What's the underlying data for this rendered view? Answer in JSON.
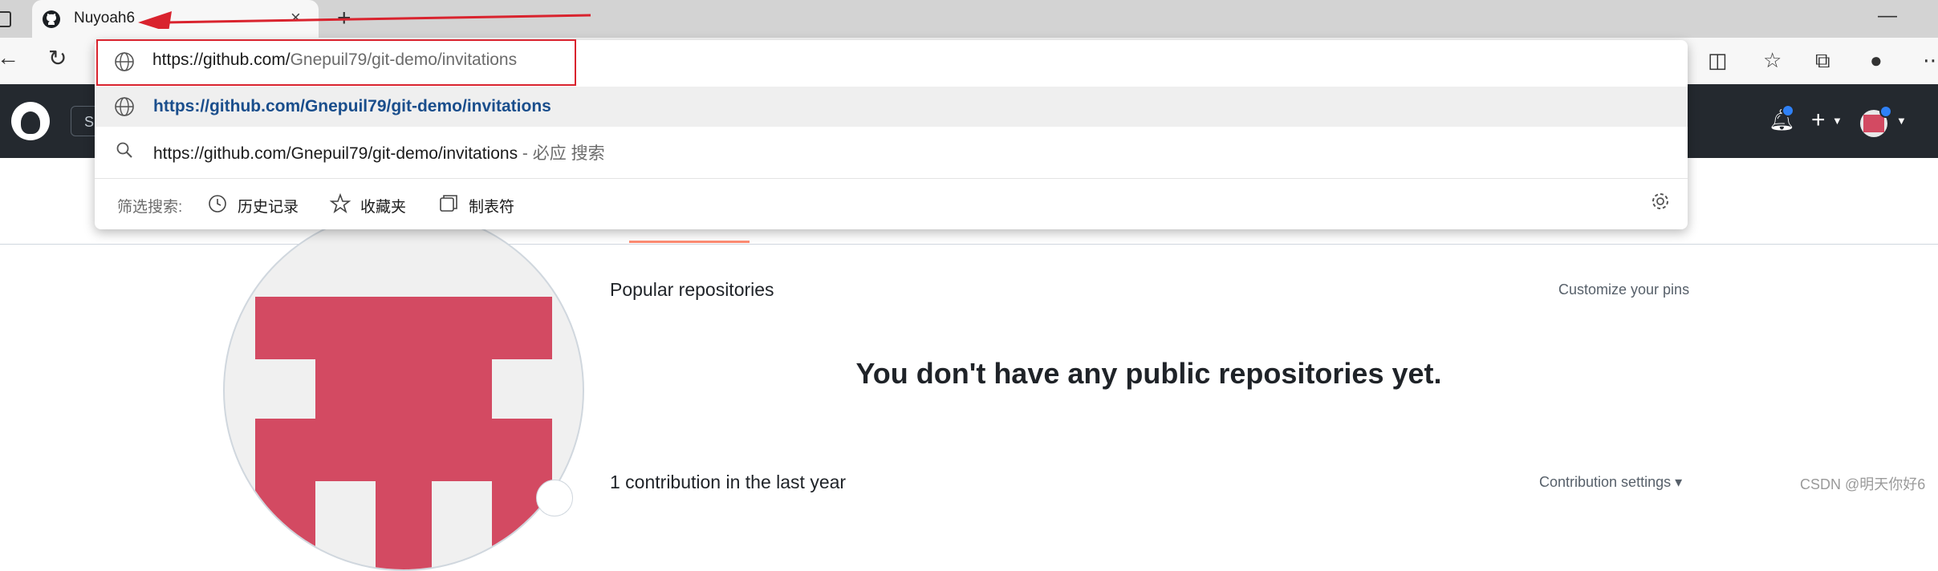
{
  "browser": {
    "tab_title": "Nuyoah6",
    "tab_close": "×",
    "new_tab": "+",
    "minimize": "—"
  },
  "address_bar": {
    "url_host": "https://github.com/",
    "url_path": "Gnepuil79/git-demo/invitations"
  },
  "suggestions": [
    {
      "text": "https://github.com/Gnepuil79/git-demo/invitations",
      "type": "url"
    },
    {
      "text": "https://github.com/Gnepuil79/git-demo/invitations",
      "suffix": " - 必应 搜索",
      "type": "search"
    }
  ],
  "filter_bar": {
    "label": "筛选搜索:",
    "items": [
      {
        "label": "历史记录",
        "icon": "history-icon"
      },
      {
        "label": "收藏夹",
        "icon": "star-icon"
      },
      {
        "label": "制表符",
        "icon": "tabs-icon"
      }
    ]
  },
  "github_header": {
    "search_stub": "S"
  },
  "profile": {
    "popular_title": "Popular repositories",
    "customize_link": "Customize your pins",
    "empty_message": "You don't have any public repositories yet.",
    "contributions_title": "1 contribution in the last year",
    "contribution_settings": "Contribution settings ▾"
  },
  "watermark": "CSDN @明天你好6",
  "colors": {
    "annotation_red": "#d9232e",
    "github_header": "#24292f",
    "identicon": "#d34a62",
    "link_blue": "#1a4e8c"
  }
}
